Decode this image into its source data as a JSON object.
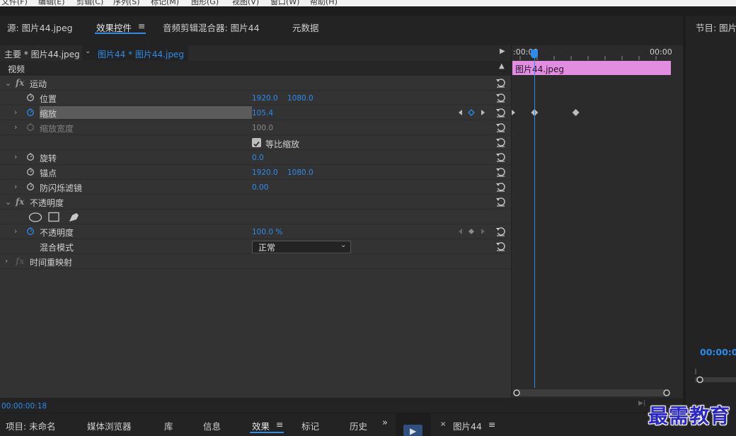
{
  "menubar": [
    "文件(F)",
    "编辑(E)",
    "剪辑(C)",
    "序列(S)",
    "标记(M)",
    "图形(G)",
    "视图(V)",
    "窗口(W)",
    "帮助(H)"
  ],
  "tabs": {
    "source": "源: 图片44.jpeg",
    "effect_controls": "效果控件",
    "menu_glyph": "≡",
    "audio_mixer": "音频剪辑混合器: 图片44",
    "metadata": "元数据"
  },
  "clip_header": {
    "main": "主要 * 图片44.jpeg",
    "sequence": "图片44 * 图片44.jpeg",
    "chevron": "⌄",
    "play": "▶"
  },
  "video_header": {
    "label": "视频",
    "caret": "▲"
  },
  "effects": {
    "motion": {
      "label": "运动",
      "position": {
        "label": "位置",
        "x": "1920.0",
        "y": "1080.0"
      },
      "scale": {
        "label": "缩放",
        "value": "105.4"
      },
      "scale_width": {
        "label": "缩放宽度",
        "value": "100.0"
      },
      "uniform_scale": {
        "label": "等比缩放",
        "checked": true
      },
      "rotation": {
        "label": "旋转",
        "value": "0.0"
      },
      "anchor": {
        "label": "锚点",
        "x": "1920.0",
        "y": "1080.0"
      },
      "anti_flicker": {
        "label": "防闪烁滤镜",
        "value": "0.00"
      }
    },
    "opacity": {
      "label": "不透明度",
      "opacity_value": {
        "label": "不透明度",
        "value": "100.0 %"
      },
      "blend_mode": {
        "label": "混合模式",
        "value": "正常"
      }
    },
    "time_remap": {
      "label": "时间重映射"
    },
    "fx_glyph": "fx"
  },
  "timeline": {
    "start_time": ":00:00",
    "end_time": "00:00",
    "clip_name": "图片44.jpeg",
    "playhead_fraction": 0.14,
    "scale_keyframes_fraction": [
      0.14,
      0.4
    ]
  },
  "timecode": "00:00:00:18",
  "status_arrows": "▶|",
  "program_panel": {
    "title": "节目: 图片",
    "time": "00:00:0"
  },
  "bottom_tabs": {
    "project": "项目: 未命名",
    "media_browser": "媒体浏览器",
    "library": "库",
    "info": "信息",
    "effects": "效果",
    "effects_menu": "≡",
    "markers": "标记",
    "history": "历史",
    "more": "»",
    "play": "▶",
    "seq_close": "×",
    "sequence": "图片44",
    "sequence_menu": "≡"
  },
  "watermark": "最需教育",
  "colors": {
    "accent": "#2d8ceb",
    "clip": "#e28ee0",
    "watermark": "#2b27c6"
  }
}
